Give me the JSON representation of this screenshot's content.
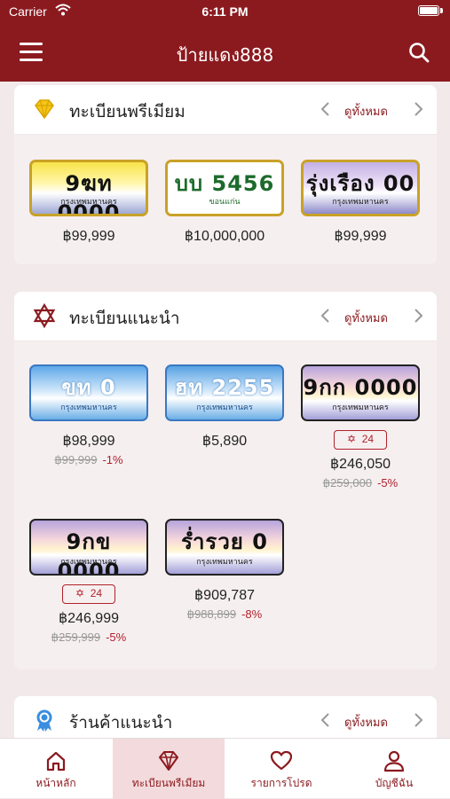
{
  "status": {
    "carrier": "Carrier",
    "time": "6:11 PM"
  },
  "header": {
    "title": "ป้ายแดง888"
  },
  "sections": {
    "premium": {
      "title": "ทะเบียนพรีเมียม",
      "see_all": "ดูทั้งหมด"
    },
    "recommended": {
      "title": "ทะเบียนแนะนำ",
      "see_all": "ดูทั้งหมด"
    },
    "shops": {
      "title": "ร้านค้าแนะนำ",
      "see_all": "ดูทั้งหมด"
    }
  },
  "premium_plates": [
    {
      "number": "9ฆท 0000",
      "province": "กรุงเทพมหานคร",
      "price": "฿99,999",
      "style": "gold"
    },
    {
      "number": "บบ 5456",
      "province": "ขอนแก่น",
      "price": "฿10,000,000",
      "style": "white"
    },
    {
      "number": "รุ่งเรือง 00",
      "province": "กรุงเทพมหานคร",
      "price": "฿99,999",
      "style": "purple"
    }
  ],
  "recommended_plates": [
    {
      "number": "ขท 0",
      "province": "กรุงเทพมหานคร",
      "price": "฿98,999",
      "old_price": "฿99,999",
      "discount": "-1%",
      "badge": ""
    },
    {
      "number": "ฮท 2255",
      "province": "กรุงเทพมหานคร",
      "price": "฿5,890",
      "old_price": "",
      "discount": "",
      "badge": ""
    },
    {
      "number": "9กก 0000",
      "province": "กรุงเทพมหานคร",
      "price": "฿246,050",
      "old_price": "฿259,000",
      "discount": "-5%",
      "badge": "24"
    },
    {
      "number": "9กข 0000",
      "province": "กรุงเทพมหานคร",
      "price": "฿246,999",
      "old_price": "฿259,999",
      "discount": "-5%",
      "badge": "24"
    },
    {
      "number": "ร่ำรวย 0",
      "province": "กรุงเทพมหานคร",
      "price": "฿909,787",
      "old_price": "฿988,899",
      "discount": "-8%",
      "badge": ""
    }
  ],
  "tabs": [
    {
      "label": "หน้าหลัก",
      "icon": "home-icon"
    },
    {
      "label": "ทะเบียนพรีเมียม",
      "icon": "diamond-icon",
      "active": true
    },
    {
      "label": "รายการโปรด",
      "icon": "heart-icon"
    },
    {
      "label": "บัญชีฉัน",
      "icon": "user-icon"
    }
  ],
  "colors": {
    "brand": "#8b1a1f",
    "accent_red": "#b0202a",
    "gold": "#c9a227"
  }
}
